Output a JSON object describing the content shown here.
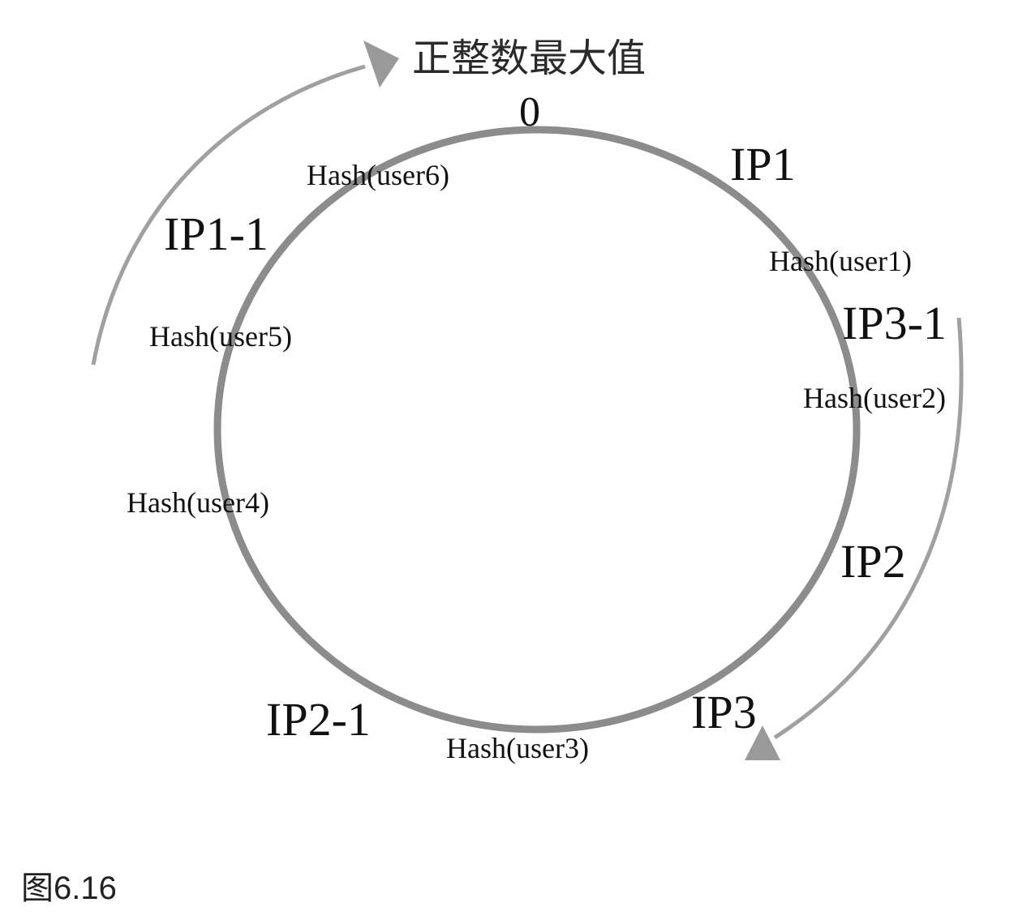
{
  "diagram": {
    "max_label": "正整数最大值",
    "zero_label": "0",
    "nodes": {
      "ip1": "IP1",
      "ip3_1": "IP3-1",
      "ip2": "IP2",
      "ip3": "IP3",
      "ip2_1": "IP2-1",
      "ip1_1": "IP1-1"
    },
    "hashes": {
      "user1": "Hash(user1)",
      "user2": "Hash(user2)",
      "user3": "Hash(user3)",
      "user4": "Hash(user4)",
      "user5": "Hash(user5)",
      "user6": "Hash(user6)"
    },
    "colors": {
      "ring": "#8c8c8c",
      "arrow": "#999999",
      "text": "#111111"
    }
  },
  "caption": "图6.16"
}
